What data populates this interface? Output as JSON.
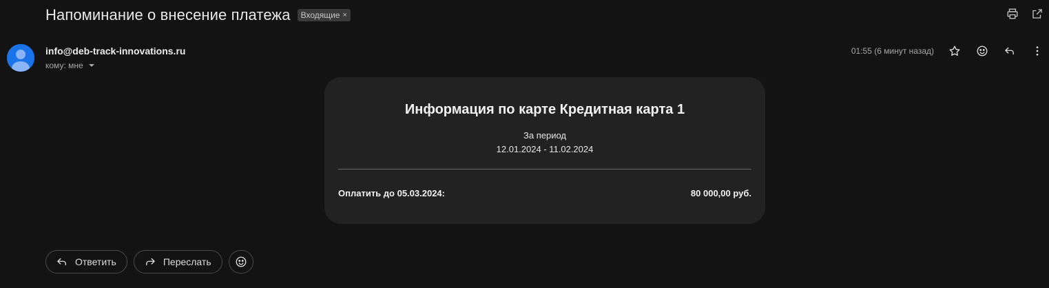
{
  "header": {
    "subject": "Напоминание о внесение платежа",
    "label": "Входящие",
    "label_close": "×",
    "actions": [
      {
        "name": "print",
        "icon": "print-icon"
      },
      {
        "name": "open-in-new-window",
        "icon": "open-in-new-icon"
      }
    ]
  },
  "message": {
    "sender": "info@deb-track-innovations.ru",
    "to_line": "кому: мне",
    "time": "01:55 (6 минут назад)",
    "actions": [
      "star-icon",
      "emoji-icon",
      "reply-icon",
      "more-vert-icon"
    ]
  },
  "card": {
    "title": "Информация по карте Кредитная карта 1",
    "period_label": "За период",
    "period_value": "12.01.2024 - 11.02.2024",
    "pay_label": "Оплатить до 05.03.2024:",
    "pay_amount": "80 000,00 руб."
  },
  "footer": {
    "reply_label": "Ответить",
    "forward_label": "Переслать",
    "emoji_icon": "emoji-icon"
  },
  "colors": {
    "background": "#131313",
    "card": "#222222",
    "avatar": "#1a73e8"
  }
}
